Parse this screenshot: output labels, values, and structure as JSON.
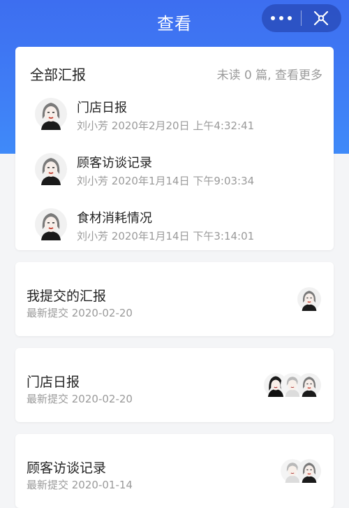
{
  "header": {
    "title": "查看"
  },
  "capsule": {
    "more_icon": "more-dots-icon",
    "close_icon": "capsule-close-icon"
  },
  "all_reports": {
    "title": "全部汇报",
    "unread_text": "未读 0 篇, 查看更多",
    "items": [
      {
        "title": "门店日报",
        "author": "刘小芳",
        "time": "2020年2月20日 上午4:32:41"
      },
      {
        "title": "顾客访谈记录",
        "author": "刘小芳",
        "time": "2020年1月14日 下午9:03:34"
      },
      {
        "title": "食材消耗情况",
        "author": "刘小芳",
        "time": "2020年1月14日 下午3:14:01"
      }
    ]
  },
  "summaries": [
    {
      "title": "我提交的汇报",
      "subtitle": "最新提交 2020-02-20"
    },
    {
      "title": "门店日报",
      "subtitle": "最新提交 2020-02-20"
    },
    {
      "title": "顾客访谈记录",
      "subtitle": "最新提交 2020-01-14"
    }
  ],
  "colors": {
    "header_blue": "#3f7cf5",
    "background": "#f4f5f7",
    "muted_text": "#9a9a9a"
  }
}
